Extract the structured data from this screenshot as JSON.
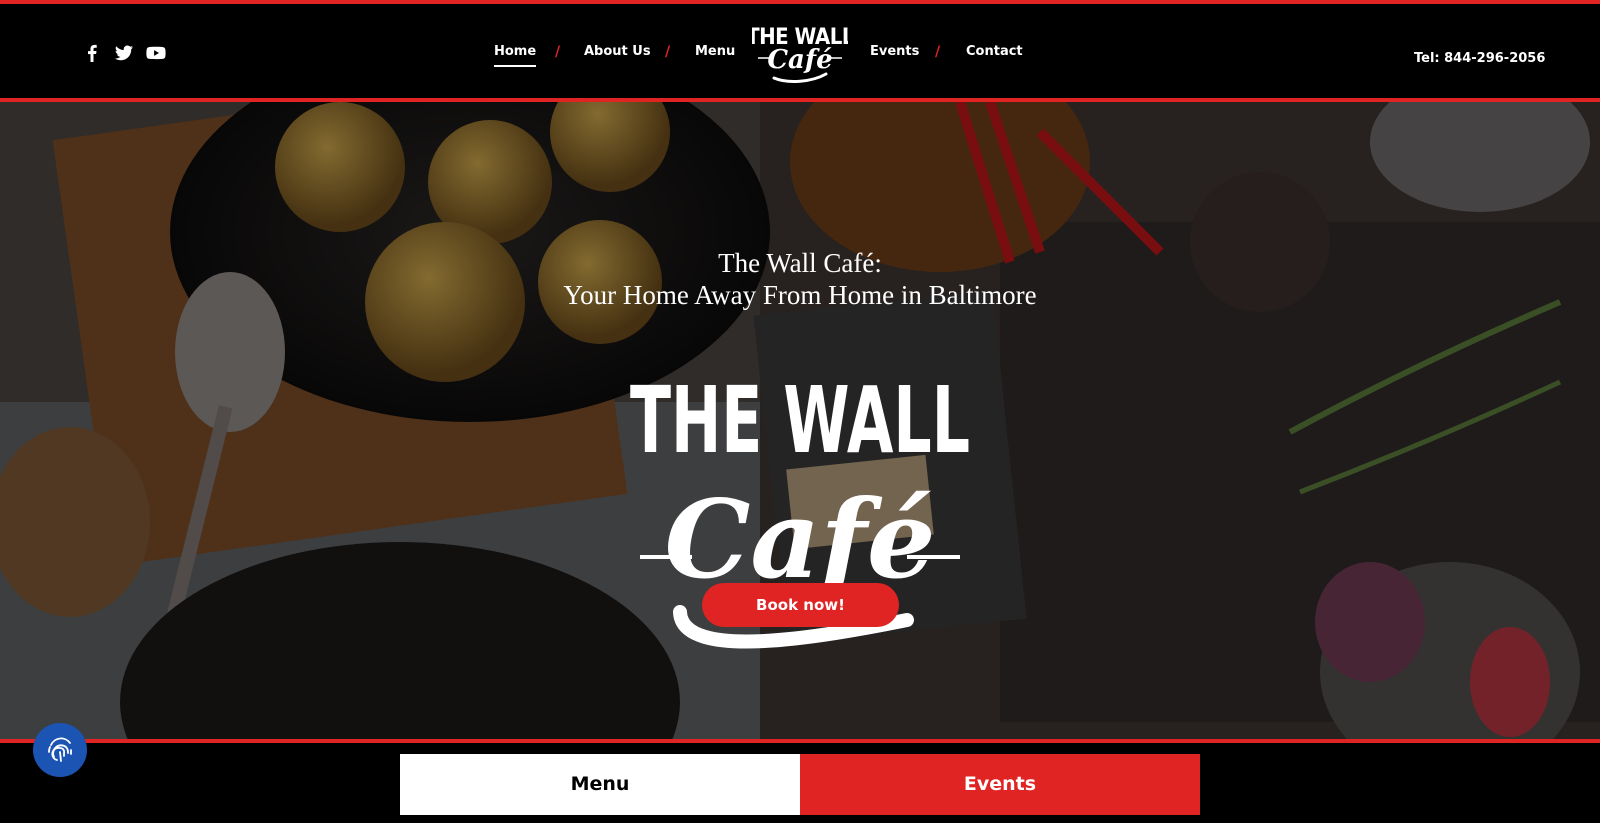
{
  "header": {
    "social": [
      {
        "name": "facebook-icon"
      },
      {
        "name": "twitter-icon"
      },
      {
        "name": "youtube-icon"
      }
    ],
    "nav": {
      "home": "Home",
      "about": "About Us",
      "menu": "Menu",
      "events": "Events",
      "contact": "Contact",
      "separator": "/"
    },
    "logo": {
      "line1": "THE WALL",
      "line2": "Café"
    },
    "phone": "Tel: 844-296-2056"
  },
  "hero": {
    "title_line1": "The Wall Café:",
    "title_line2": "Your Home Away From Home in Baltimore",
    "logo": {
      "line1": "THE WALL",
      "line2": "Café"
    },
    "book_button": "Book now!"
  },
  "bottom": {
    "menu_label": "Menu",
    "events_label": "Events"
  },
  "accessibility": {
    "icon": "fingerprint-icon"
  },
  "colors": {
    "accent": "#e02323",
    "background": "#000000",
    "accessibility": "#1c54b3"
  }
}
